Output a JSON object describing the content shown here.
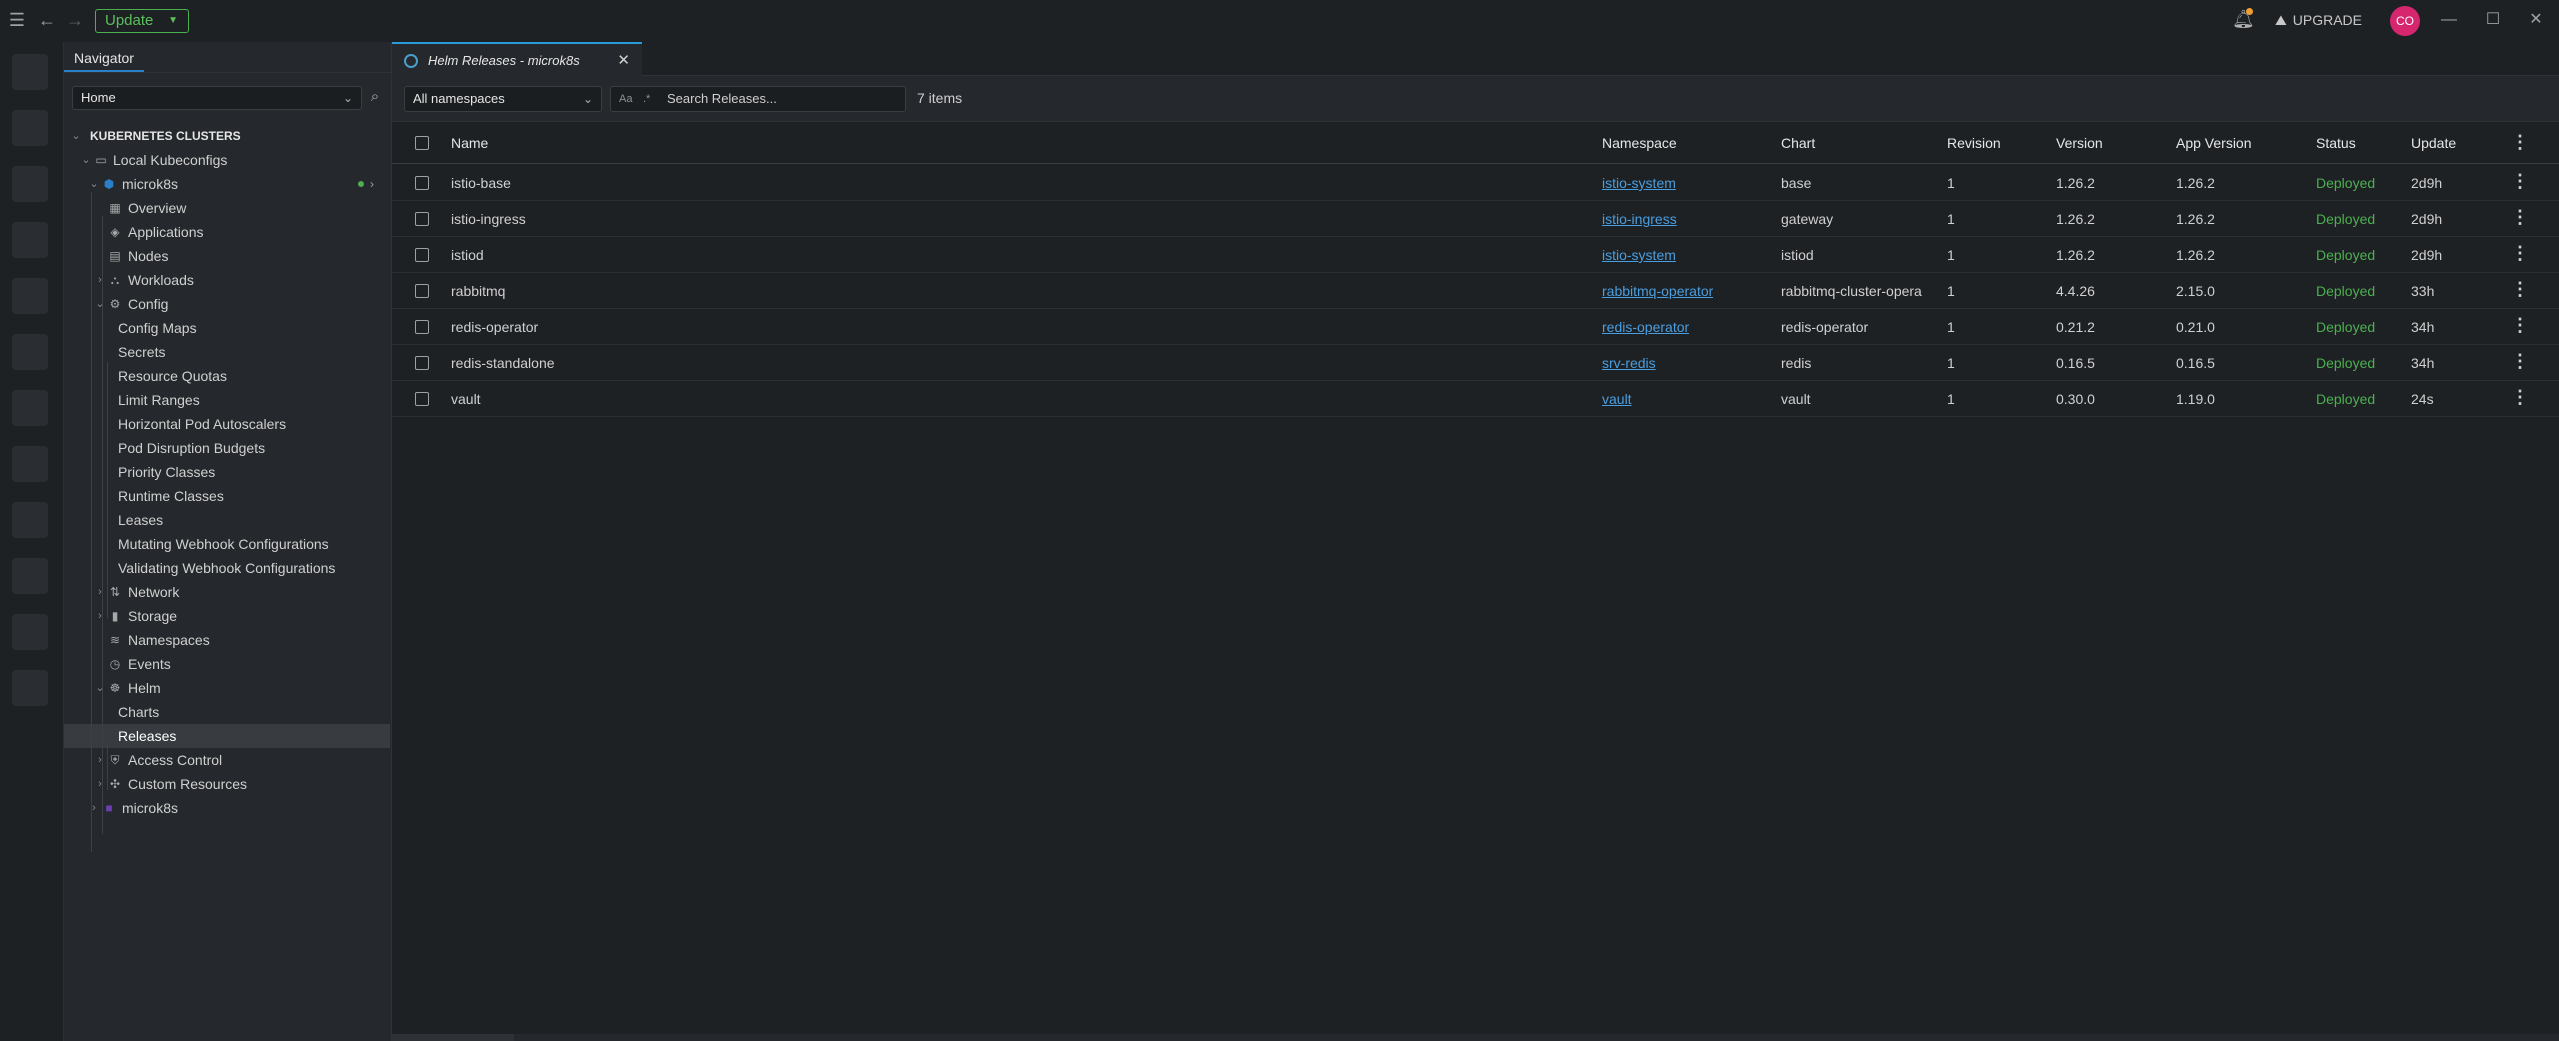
{
  "topbar": {
    "update_label": "Update",
    "upgrade_label": "UPGRADE",
    "avatar_initials": "CO"
  },
  "sidebar": {
    "nav_tab": "Navigator",
    "hotbar_select": "Home",
    "clusters_header": "KUBERNETES CLUSTERS",
    "local_kubeconfigs": "Local Kubeconfigs",
    "cluster_name": "microk8s",
    "items": {
      "overview": "Overview",
      "applications": "Applications",
      "nodes": "Nodes",
      "workloads": "Workloads",
      "config": "Config",
      "config_maps": "Config Maps",
      "secrets": "Secrets",
      "resource_quotas": "Resource Quotas",
      "limit_ranges": "Limit Ranges",
      "hpa": "Horizontal Pod Autoscalers",
      "pdb": "Pod Disruption Budgets",
      "priority_classes": "Priority Classes",
      "runtime_classes": "Runtime Classes",
      "leases": "Leases",
      "mutating": "Mutating Webhook Configurations",
      "validating": "Validating Webhook Configurations",
      "network": "Network",
      "storage": "Storage",
      "namespaces": "Namespaces",
      "events": "Events",
      "helm": "Helm",
      "charts": "Charts",
      "releases": "Releases",
      "access_control": "Access Control",
      "custom_resources": "Custom Resources"
    },
    "second_cluster": "microk8s"
  },
  "main": {
    "tab_title": "Helm Releases - microk8s",
    "namespace_filter": "All namespaces",
    "search_placeholder": "Search Releases...",
    "items_count": "7 items",
    "columns": [
      "Name",
      "Namespace",
      "Chart",
      "Revision",
      "Version",
      "App Version",
      "Status",
      "Update"
    ],
    "rows": [
      {
        "name": "istio-base",
        "namespace": "istio-system",
        "chart": "base",
        "revision": "1",
        "version": "1.26.2",
        "app_version": "1.26.2",
        "status": "Deployed",
        "updated": "2d9h"
      },
      {
        "name": "istio-ingress",
        "namespace": "istio-ingress",
        "chart": "gateway",
        "revision": "1",
        "version": "1.26.2",
        "app_version": "1.26.2",
        "status": "Deployed",
        "updated": "2d9h"
      },
      {
        "name": "istiod",
        "namespace": "istio-system",
        "chart": "istiod",
        "revision": "1",
        "version": "1.26.2",
        "app_version": "1.26.2",
        "status": "Deployed",
        "updated": "2d9h"
      },
      {
        "name": "rabbitmq",
        "namespace": "rabbitmq-operator",
        "chart": "rabbitmq-cluster-opera",
        "revision": "1",
        "version": "4.4.26",
        "app_version": "2.15.0",
        "status": "Deployed",
        "updated": "33h"
      },
      {
        "name": "redis-operator",
        "namespace": "redis-operator",
        "chart": "redis-operator",
        "revision": "1",
        "version": "0.21.2",
        "app_version": "0.21.0",
        "status": "Deployed",
        "updated": "34h"
      },
      {
        "name": "redis-standalone",
        "namespace": "srv-redis",
        "chart": "redis",
        "revision": "1",
        "version": "0.16.5",
        "app_version": "0.16.5",
        "status": "Deployed",
        "updated": "34h"
      },
      {
        "name": "vault",
        "namespace": "vault",
        "chart": "vault",
        "revision": "1",
        "version": "0.30.0",
        "app_version": "1.19.0",
        "status": "Deployed",
        "updated": "24s"
      }
    ]
  },
  "colors": {
    "accent": "#2a9bd8",
    "status_deployed": "#4caf50",
    "link": "#4a9ee0",
    "avatar": "#d6266e",
    "update_button": "#4caf50"
  }
}
